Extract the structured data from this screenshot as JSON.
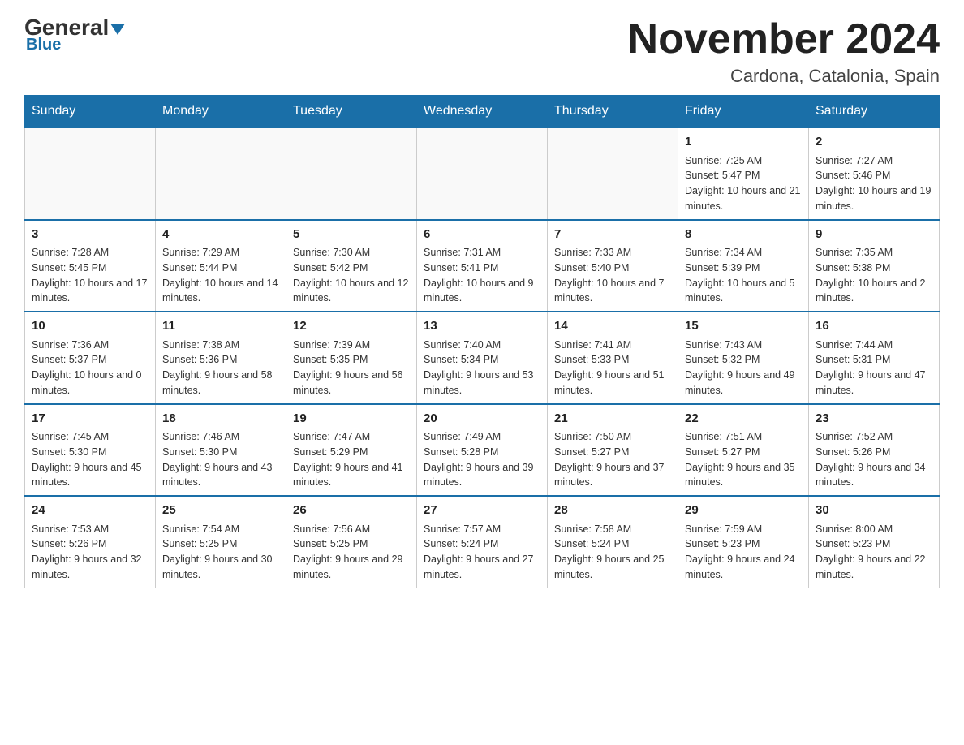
{
  "header": {
    "logo_general": "General",
    "logo_blue": "Blue",
    "month_title": "November 2024",
    "location": "Cardona, Catalonia, Spain"
  },
  "days_of_week": [
    "Sunday",
    "Monday",
    "Tuesday",
    "Wednesday",
    "Thursday",
    "Friday",
    "Saturday"
  ],
  "weeks": [
    [
      {
        "day": "",
        "info": ""
      },
      {
        "day": "",
        "info": ""
      },
      {
        "day": "",
        "info": ""
      },
      {
        "day": "",
        "info": ""
      },
      {
        "day": "",
        "info": ""
      },
      {
        "day": "1",
        "info": "Sunrise: 7:25 AM\nSunset: 5:47 PM\nDaylight: 10 hours and 21 minutes."
      },
      {
        "day": "2",
        "info": "Sunrise: 7:27 AM\nSunset: 5:46 PM\nDaylight: 10 hours and 19 minutes."
      }
    ],
    [
      {
        "day": "3",
        "info": "Sunrise: 7:28 AM\nSunset: 5:45 PM\nDaylight: 10 hours and 17 minutes."
      },
      {
        "day": "4",
        "info": "Sunrise: 7:29 AM\nSunset: 5:44 PM\nDaylight: 10 hours and 14 minutes."
      },
      {
        "day": "5",
        "info": "Sunrise: 7:30 AM\nSunset: 5:42 PM\nDaylight: 10 hours and 12 minutes."
      },
      {
        "day": "6",
        "info": "Sunrise: 7:31 AM\nSunset: 5:41 PM\nDaylight: 10 hours and 9 minutes."
      },
      {
        "day": "7",
        "info": "Sunrise: 7:33 AM\nSunset: 5:40 PM\nDaylight: 10 hours and 7 minutes."
      },
      {
        "day": "8",
        "info": "Sunrise: 7:34 AM\nSunset: 5:39 PM\nDaylight: 10 hours and 5 minutes."
      },
      {
        "day": "9",
        "info": "Sunrise: 7:35 AM\nSunset: 5:38 PM\nDaylight: 10 hours and 2 minutes."
      }
    ],
    [
      {
        "day": "10",
        "info": "Sunrise: 7:36 AM\nSunset: 5:37 PM\nDaylight: 10 hours and 0 minutes."
      },
      {
        "day": "11",
        "info": "Sunrise: 7:38 AM\nSunset: 5:36 PM\nDaylight: 9 hours and 58 minutes."
      },
      {
        "day": "12",
        "info": "Sunrise: 7:39 AM\nSunset: 5:35 PM\nDaylight: 9 hours and 56 minutes."
      },
      {
        "day": "13",
        "info": "Sunrise: 7:40 AM\nSunset: 5:34 PM\nDaylight: 9 hours and 53 minutes."
      },
      {
        "day": "14",
        "info": "Sunrise: 7:41 AM\nSunset: 5:33 PM\nDaylight: 9 hours and 51 minutes."
      },
      {
        "day": "15",
        "info": "Sunrise: 7:43 AM\nSunset: 5:32 PM\nDaylight: 9 hours and 49 minutes."
      },
      {
        "day": "16",
        "info": "Sunrise: 7:44 AM\nSunset: 5:31 PM\nDaylight: 9 hours and 47 minutes."
      }
    ],
    [
      {
        "day": "17",
        "info": "Sunrise: 7:45 AM\nSunset: 5:30 PM\nDaylight: 9 hours and 45 minutes."
      },
      {
        "day": "18",
        "info": "Sunrise: 7:46 AM\nSunset: 5:30 PM\nDaylight: 9 hours and 43 minutes."
      },
      {
        "day": "19",
        "info": "Sunrise: 7:47 AM\nSunset: 5:29 PM\nDaylight: 9 hours and 41 minutes."
      },
      {
        "day": "20",
        "info": "Sunrise: 7:49 AM\nSunset: 5:28 PM\nDaylight: 9 hours and 39 minutes."
      },
      {
        "day": "21",
        "info": "Sunrise: 7:50 AM\nSunset: 5:27 PM\nDaylight: 9 hours and 37 minutes."
      },
      {
        "day": "22",
        "info": "Sunrise: 7:51 AM\nSunset: 5:27 PM\nDaylight: 9 hours and 35 minutes."
      },
      {
        "day": "23",
        "info": "Sunrise: 7:52 AM\nSunset: 5:26 PM\nDaylight: 9 hours and 34 minutes."
      }
    ],
    [
      {
        "day": "24",
        "info": "Sunrise: 7:53 AM\nSunset: 5:26 PM\nDaylight: 9 hours and 32 minutes."
      },
      {
        "day": "25",
        "info": "Sunrise: 7:54 AM\nSunset: 5:25 PM\nDaylight: 9 hours and 30 minutes."
      },
      {
        "day": "26",
        "info": "Sunrise: 7:56 AM\nSunset: 5:25 PM\nDaylight: 9 hours and 29 minutes."
      },
      {
        "day": "27",
        "info": "Sunrise: 7:57 AM\nSunset: 5:24 PM\nDaylight: 9 hours and 27 minutes."
      },
      {
        "day": "28",
        "info": "Sunrise: 7:58 AM\nSunset: 5:24 PM\nDaylight: 9 hours and 25 minutes."
      },
      {
        "day": "29",
        "info": "Sunrise: 7:59 AM\nSunset: 5:23 PM\nDaylight: 9 hours and 24 minutes."
      },
      {
        "day": "30",
        "info": "Sunrise: 8:00 AM\nSunset: 5:23 PM\nDaylight: 9 hours and 22 minutes."
      }
    ]
  ]
}
